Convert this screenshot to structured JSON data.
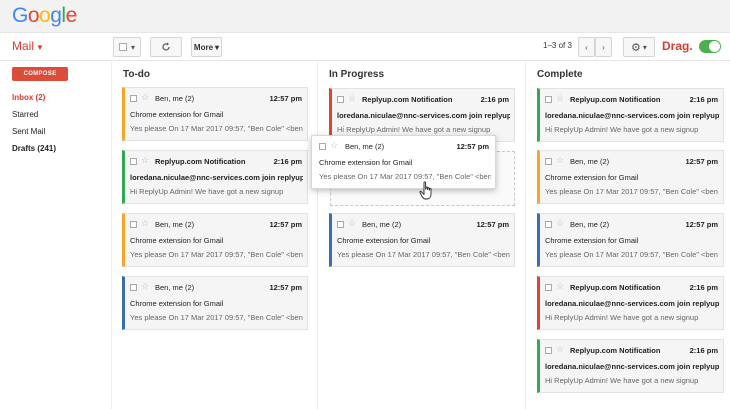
{
  "logo": {
    "letters": [
      "G",
      "o",
      "o",
      "g",
      "l",
      "e"
    ],
    "colors": [
      "#4285f4",
      "#ea4335",
      "#fbbc05",
      "#4285f4",
      "#34a853",
      "#ea4335"
    ]
  },
  "toolbar": {
    "mail_label": "Mail",
    "more_label": "More",
    "page_count": "1–3 of 3",
    "drag_label": "Drag."
  },
  "sidebar": {
    "compose_label": "COMPOSE",
    "items": [
      {
        "label": "Inbox (2)"
      },
      {
        "label": "Starred"
      },
      {
        "label": "Sent Mail"
      },
      {
        "label": "Drafts (241)"
      }
    ]
  },
  "columns": {
    "todo": {
      "title": "To-do",
      "cards": [
        {
          "sender": "Ben, me (2)",
          "time": "12:57 pm",
          "subject": "Chrome extension for Gmail",
          "snippet": "Yes please On 17 Mar 2017 09:57, \"Ben Cole\" <ben"
        },
        {
          "sender": "Replyup.com Notification",
          "time": "2:16 pm",
          "subject": "loredana.niculae@nnc-services.com join replyup",
          "snippet": "Hi ReplyUp Admin! We have got a new signup"
        },
        {
          "sender": "Ben, me (2)",
          "time": "12:57 pm",
          "subject": "Chrome extension for Gmail",
          "snippet": "Yes please On 17 Mar 2017 09:57, \"Ben Cole\" <ben"
        },
        {
          "sender": "Ben, me (2)",
          "time": "12:57 pm",
          "subject": "Chrome extension for Gmail",
          "snippet": "Yes please On 17 Mar 2017 09:57, \"Ben Cole\" <ben"
        }
      ]
    },
    "progress": {
      "title": "In Progress",
      "cards": [
        {
          "sender": "Replyup.com Notification",
          "time": "2:16 pm",
          "subject": "loredana.niculae@nnc-services.com join replyup",
          "snippet": "Hi ReplyUp Admin! We have got a new signup"
        },
        {
          "sender": "Ben, me (2)",
          "time": "12:57 pm",
          "subject": "Chrome extension for Gmail",
          "snippet": "Yes please On 17 Mar 2017 09:57, \"Ben Cole\" <ben"
        }
      ],
      "dragging": {
        "sender": "Ben, me (2)",
        "time": "12:57 pm",
        "subject": "Chrome extension for Gmail",
        "snippet": "Yes please On 17 Mar 2017 09:57, \"Ben Cole\" <ben"
      }
    },
    "complete": {
      "title": "Complete",
      "cards": [
        {
          "sender": "Replyup.com Notification",
          "time": "2:16 pm",
          "subject": "loredana.niculae@nnc-services.com join replyup",
          "snippet": "Hi ReplyUp Admin! We have got a new signup"
        },
        {
          "sender": "Ben, me (2)",
          "time": "12:57 pm",
          "subject": "Chrome extension for Gmail",
          "snippet": "Yes please On 17 Mar 2017 09:57, \"Ben Cole\" <ben"
        },
        {
          "sender": "Ben, me (2)",
          "time": "12:57 pm",
          "subject": "Chrome extension for Gmail",
          "snippet": "Yes please On 17 Mar 2017 09:57, \"Ben Cole\" <ben"
        },
        {
          "sender": "Replyup.com Notification",
          "time": "2:16 pm",
          "subject": "loredana.niculae@nnc-services.com join replyup",
          "snippet": "Hi ReplyUp Admin! We have got a new signup"
        },
        {
          "sender": "Replyup.com Notification",
          "time": "2:16 pm",
          "subject": "loredana.niculae@nnc-services.com join replyup",
          "snippet": "Hi ReplyUp Admin! We have got a new signup"
        }
      ]
    }
  },
  "label_colors": {
    "orange": "#f4a62a",
    "green": "#35a853",
    "blue": "#3a6ea8",
    "red": "#db4437"
  }
}
